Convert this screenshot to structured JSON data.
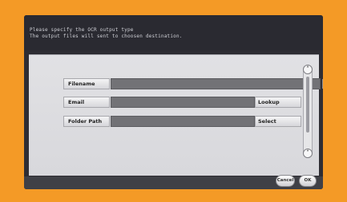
{
  "header": {
    "line1": "Please specify the OCR output type",
    "line2": "The output files will sent to choosen destination."
  },
  "rows": [
    {
      "label": "Filename",
      "value": "",
      "action": null
    },
    {
      "label": "Email",
      "value": "",
      "action": "Lookup"
    },
    {
      "label": "Folder Path",
      "value": "",
      "action": "Select"
    }
  ],
  "scroll": {
    "up_glyph": "˄",
    "down_glyph": "˅"
  },
  "footer": {
    "cancel_label": "Cancel",
    "ok_label": "OK"
  },
  "colors": {
    "frame": "#f49a26",
    "screen": "#2e2d33",
    "panel": "#dcdce0",
    "field": "#727276"
  }
}
